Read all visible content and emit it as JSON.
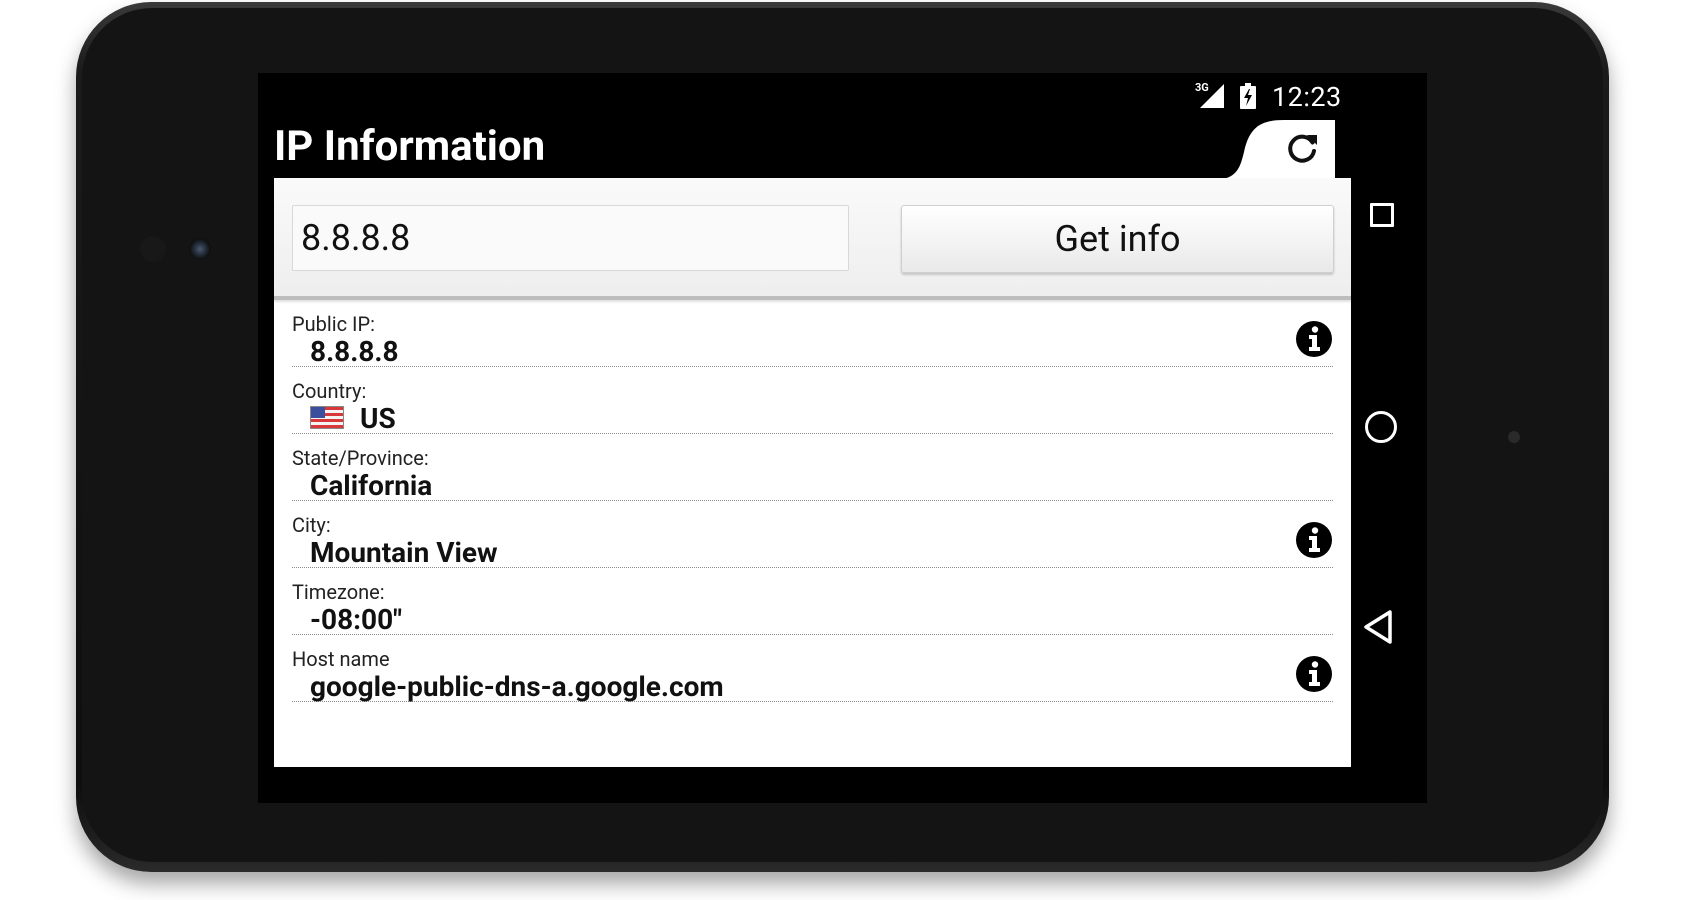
{
  "status_bar": {
    "network": "3G",
    "time": "12:23"
  },
  "app_bar": {
    "title": "IP Information",
    "refresh_icon": "refresh-icon"
  },
  "search": {
    "ip_value": "8.8.8.8",
    "button_label": "Get info"
  },
  "results": [
    {
      "label": "Public IP:",
      "value": "8.8.8.8",
      "has_info": true,
      "has_flag": false
    },
    {
      "label": "Country:",
      "value": "US",
      "has_info": false,
      "has_flag": true,
      "flag_icon": "us-flag-icon"
    },
    {
      "label": "State/Province:",
      "value": "California",
      "has_info": false,
      "has_flag": false
    },
    {
      "label": "City:",
      "value": "Mountain View",
      "has_info": true,
      "has_flag": false
    },
    {
      "label": "Timezone:",
      "value": "-08:00\"",
      "has_info": false,
      "has_flag": false
    },
    {
      "label": "Host name",
      "value": "google-public-dns-a.google.com",
      "has_info": true,
      "has_flag": false
    }
  ],
  "nav_bar": {
    "icons": [
      "recent-apps-icon",
      "home-icon",
      "back-icon"
    ]
  },
  "colors": {
    "app_bar": "#000000",
    "panel": "#ffffff",
    "text": "#111111"
  }
}
